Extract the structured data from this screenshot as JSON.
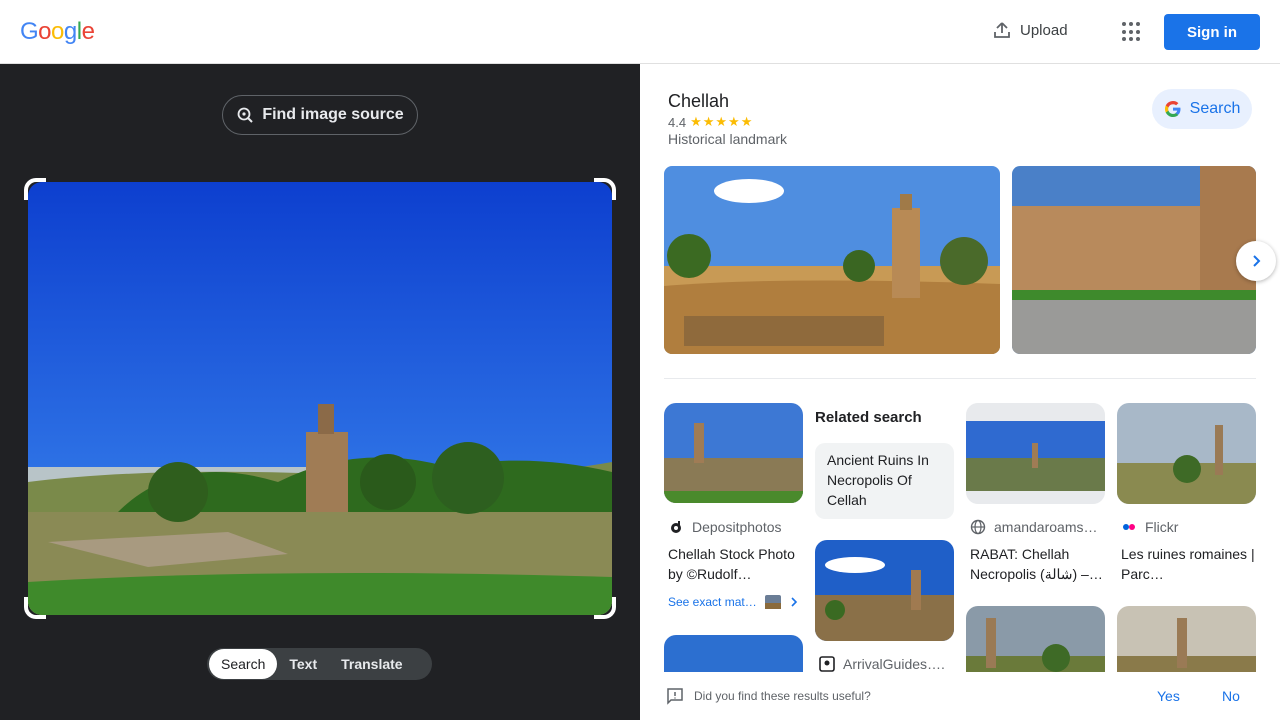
{
  "header": {
    "logo_letters": [
      "G",
      "o",
      "o",
      "g",
      "l",
      "e"
    ],
    "logo_colors": [
      "#4285f4",
      "#ea4335",
      "#fbbc05",
      "#4285f4",
      "#34a853",
      "#ea4335"
    ],
    "upload_label": "Upload",
    "signin_label": "Sign in",
    "accent_color": "#1a73e8"
  },
  "left_panel": {
    "find_source_label": "Find image source",
    "modes": [
      {
        "label": "Search",
        "active": true
      },
      {
        "label": "Text",
        "active": false
      },
      {
        "label": "Translate",
        "active": false
      }
    ]
  },
  "entity": {
    "title": "Chellah",
    "rating": "4.4",
    "stars": "★★★★★",
    "type": "Historical landmark",
    "search_label": "Search"
  },
  "results": {
    "related_heading": "Related search",
    "related_query": "Ancient Ruins In Necropolis Of Cellah",
    "items": [
      {
        "source": "Depositphotos",
        "title": "Chellah Stock Photo by ©Rudolf…",
        "see_exact": "See exact mat…"
      },
      {
        "source": "amandaroams…",
        "title": "RABAT: Chellah Necropolis (شالة) –…"
      },
      {
        "source": "Flickr",
        "title": "Les ruines romaines | Parc…"
      },
      {
        "source": "ArrivalGuides…."
      }
    ]
  },
  "feedback": {
    "question": "Did you find these results useful?",
    "yes": "Yes",
    "no": "No"
  }
}
